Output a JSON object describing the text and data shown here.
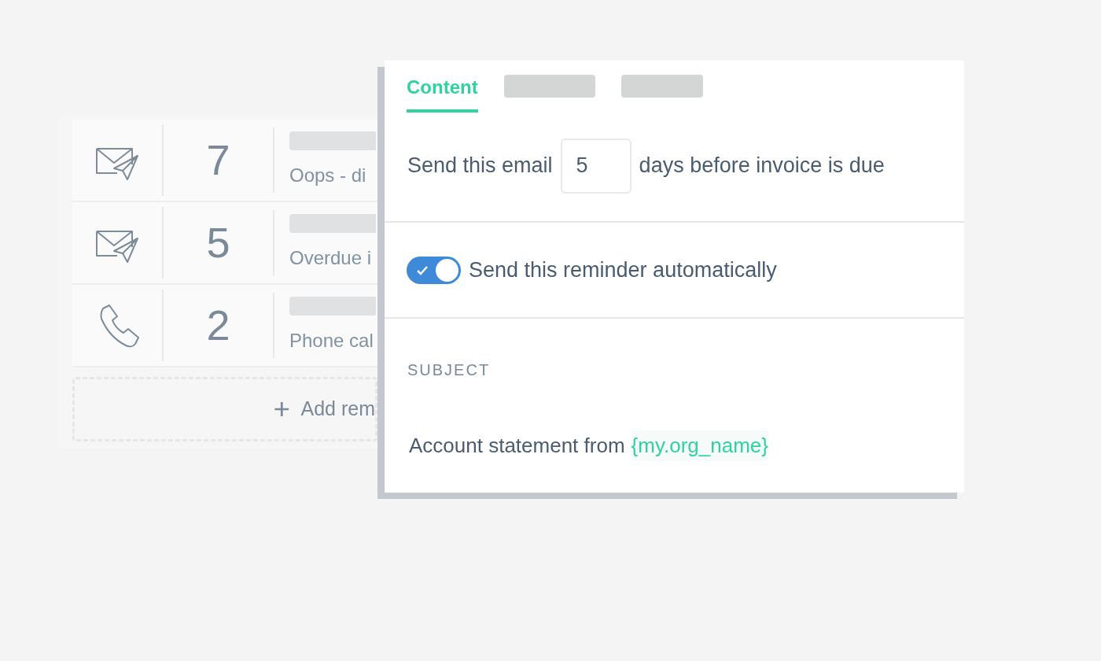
{
  "reminders": [
    {
      "kind": "email",
      "days": "7",
      "description": "Oops - di"
    },
    {
      "kind": "email",
      "days": "5",
      "description": "Overdue i"
    },
    {
      "kind": "phone",
      "days": "2",
      "description": "Phone cal"
    }
  ],
  "add_button": {
    "label": "Add rem"
  },
  "editor": {
    "tabs": [
      {
        "label": "Content",
        "selected": true
      },
      {
        "selected": false
      },
      {
        "selected": false
      }
    ],
    "timing": {
      "before": "Send this email",
      "value": "5",
      "after": "days before invoice is due"
    },
    "auto_send": {
      "label": "Send this reminder automatically",
      "on": true
    },
    "subject": {
      "heading": "SUBJECT",
      "text": "Account statement from",
      "variable": "{my.org_name}"
    }
  }
}
